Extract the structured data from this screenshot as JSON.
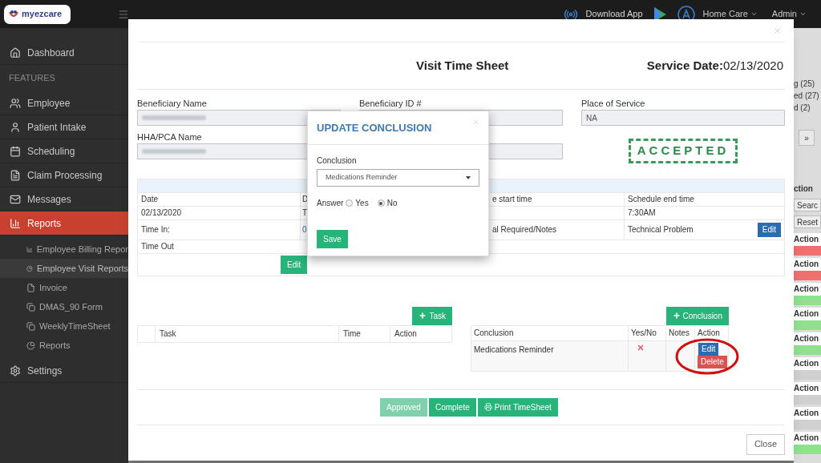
{
  "top_bar": {
    "logo_text": "myezcare",
    "download_label": "Download App",
    "menus": [
      {
        "label": "Home Care"
      },
      {
        "label": "Admin"
      }
    ]
  },
  "sidebar": {
    "items": [
      {
        "label": "Dashboard",
        "kind": "item",
        "selected": false
      },
      {
        "label": "FEATURES",
        "kind": "heading"
      },
      {
        "label": "Employee",
        "kind": "item",
        "selected": false
      },
      {
        "label": "Patient Intake",
        "kind": "item",
        "selected": false
      },
      {
        "label": "Scheduling",
        "kind": "item",
        "selected": false
      },
      {
        "label": "Claim Processing",
        "kind": "item",
        "selected": false
      },
      {
        "label": "Messages",
        "kind": "item",
        "selected": false
      },
      {
        "label": "Reports",
        "kind": "item",
        "selected": true,
        "children": [
          {
            "label": "Employee Billing Repor",
            "selected": false
          },
          {
            "label": "Employee Visit Reports",
            "selected": true
          },
          {
            "label": "Invoice",
            "selected": false
          },
          {
            "label": "DMAS_90 Form",
            "selected": false
          },
          {
            "label": "WeeklyTimeSheet",
            "selected": false
          },
          {
            "label": "Reports",
            "selected": false
          }
        ]
      },
      {
        "label": "Settings",
        "kind": "item",
        "selected": false
      }
    ]
  },
  "background_list": {
    "counts": [
      "g (25)",
      "ed (27)",
      "d (2)"
    ],
    "pager_next": "»",
    "column_header": "ction",
    "buttons": [
      "Searc",
      "Reset"
    ],
    "rows": [
      {
        "label": "Action",
        "color": "#f07070"
      },
      {
        "label": "Action",
        "color": "#f07070"
      },
      {
        "label": "Action",
        "color": "#90e090"
      },
      {
        "label": "Action",
        "color": "#90e090"
      },
      {
        "label": "Action",
        "color": "#90e090"
      },
      {
        "label": "Action",
        "color": "#d0d0d0"
      },
      {
        "label": "Action",
        "color": "#d0d0d0"
      },
      {
        "label": "Action",
        "color": "#d0d0d0"
      },
      {
        "label": "Action",
        "color": "#90e090"
      }
    ]
  },
  "modal": {
    "title": "Visit Time Sheet",
    "service_date": "**Service Date:**02/13/2020",
    "fields": [
      {
        "label": "Beneficiary Name",
        "kind": "redacted"
      },
      {
        "label": "Beneficiary ID #",
        "kind": "text"
      },
      {
        "label": "Place of Service",
        "value": "NA",
        "kind": "text"
      },
      {
        "label": "HHA/PCA Name",
        "kind": "redacted"
      },
      {
        "kind": "text"
      }
    ],
    "stamp": "ACCEPTED",
    "visit_table": {
      "rows": [
        [
          "Date",
          "D",
          "e start time",
          "Schedule end time"
        ],
        [
          "02/13/2020",
          "T",
          null,
          "7:30AM"
        ],
        [
          "Time In:",
          {
            "text": "0",
            "kind": "link"
          },
          "al Required/Notes",
          "Technical Problem"
        ],
        [
          "Time Out",
          null,
          null,
          null
        ]
      ],
      "row_edit": "Edit",
      "bottom_edit": "Edit"
    },
    "tasks": {
      "add_button": "Task",
      "columns": [
        "Task",
        "Time",
        "Action"
      ]
    },
    "conclusions": {
      "add_button": "Conclusion",
      "columns": [
        "Conclusion",
        "Yes/No",
        "Notes",
        "Action"
      ],
      "rows": [
        {
          "conclusion": "Medications Reminder",
          "answer": false,
          "actions": [
            "Edit",
            "Delete"
          ]
        }
      ]
    },
    "footer_buttons": [
      {
        "label": "Approved",
        "kind": "plain",
        "disabled": true
      },
      {
        "label": "Complete",
        "kind": "plain",
        "disabled": false
      },
      {
        "label": "Print TimeSheet",
        "kind": "print",
        "disabled": false
      }
    ],
    "close_button": "Close"
  },
  "dialog": {
    "title": "UPDATE CONCLUSION",
    "field_label": "Conclusion",
    "select_value": "Medications Reminder",
    "answer_label": "Answer",
    "options": [
      {
        "label": "Yes",
        "selected": false
      },
      {
        "label": "No",
        "selected": true
      }
    ],
    "save_button": "Save"
  }
}
